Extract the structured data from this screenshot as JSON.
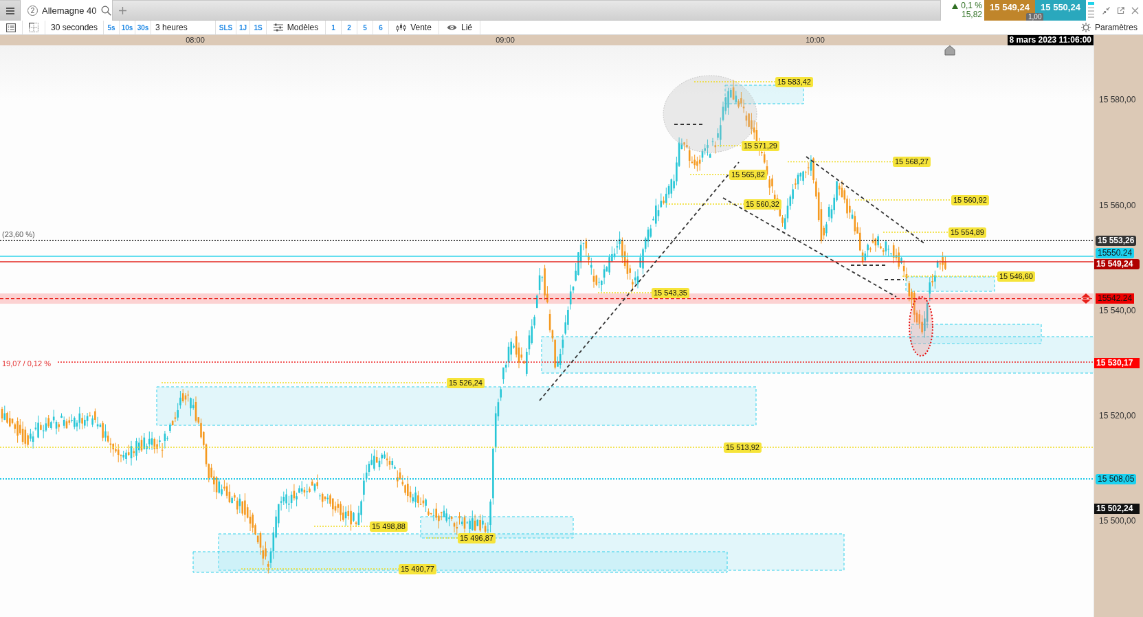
{
  "tabs": [
    {
      "number": "2",
      "label": "Allemagne 40",
      "selected": true
    }
  ],
  "quote": {
    "up": true,
    "change_percent": "0,1 %",
    "change_points": "15,82",
    "sell_price": "15 549,24",
    "buy_price": "15 550,24",
    "spread": "1,00"
  },
  "toolbar": {
    "interval": "30 secondes",
    "interval_presets": [
      "5s",
      "10s",
      "30s"
    ],
    "range": "3 heures",
    "range_presets": [
      "SLS",
      "1J",
      "1S"
    ],
    "templates": "Modèles",
    "template_presets": [
      "1",
      "2",
      "5",
      "6"
    ],
    "chart_type": "Vente",
    "link": "Lié",
    "settings": "Paramètres"
  },
  "time_axis": {
    "labels": [
      "08:00",
      "09:00",
      "10:00"
    ],
    "cursor_time": "8 mars 2023 11:06:00"
  },
  "price_axis": {
    "labels": [
      "15 580,00",
      "15 560,00",
      "15 540,00",
      "15 520,00",
      "15 500,00"
    ]
  },
  "levels": [
    {
      "kind": "fibonacci",
      "note": "(23,60 %)",
      "tag": "15 553,26"
    },
    {
      "kind": "ask",
      "tag": "15550.24"
    },
    {
      "kind": "bid",
      "tag": "15 549,24"
    },
    {
      "kind": "order",
      "tag": "15542.24"
    },
    {
      "kind": "distance",
      "note": "19,07 / 0,12 %",
      "tag": "15 530,17"
    },
    {
      "kind": "horizontal",
      "tag": "15 508,05"
    },
    {
      "kind": "reference",
      "tag": "15 502,24"
    }
  ],
  "price_labels": [
    "15 583,42",
    "15 571,29",
    "15 568,27",
    "15 565,82",
    "15 560,92",
    "15 560,32",
    "15 554,89",
    "15 546,60",
    "15 543,35",
    "15 526,24",
    "15 513,92",
    "15 498,88",
    "15 496,87",
    "15 490,77"
  ]
}
